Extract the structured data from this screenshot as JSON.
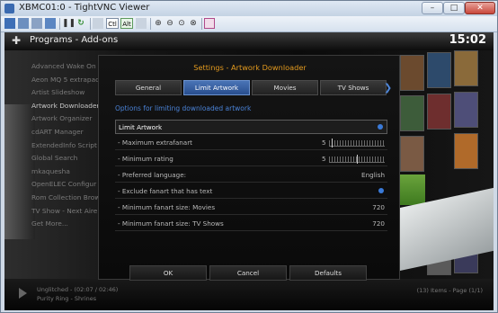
{
  "window": {
    "title": "XBMC01:0 - TightVNC Viewer",
    "controls": {
      "minimize": "–",
      "maximize": "□",
      "close": "✕"
    }
  },
  "toolbar": {
    "icons": [
      "new-connection-icon",
      "save-icon",
      "options-icon",
      "info-icon",
      "pause-icon",
      "refresh-icon",
      "ctrl-alt-del-icon",
      "ctrl-key-icon",
      "alt-key-icon",
      "clipboard-icon",
      "zoom-in-icon",
      "zoom-out-icon",
      "zoom-100-icon",
      "zoom-fit-icon",
      "fullscreen-icon"
    ],
    "ctrl_label": "Ctl",
    "alt_label": "Alt"
  },
  "xbmc": {
    "header_title": "Programs  -  Add-ons",
    "clock": "15:02",
    "list": [
      "Advanced Wake On",
      "Aeon MQ 5 extrapac",
      "Artist Slideshow",
      "Artwork Downloader",
      "Artwork Organizer",
      "cdART Manager",
      "ExtendedInfo Script",
      "Global Search",
      "mkaquesha",
      "OpenELEC Configur",
      "Rom Collection Brow",
      "TV Show - Next Aire",
      "Get More..."
    ],
    "footer": {
      "now_playing_1": "Unglitched - (02:07 / 02:46)",
      "now_playing_2": "Purity Ring - Shrines",
      "items_text": "(13) Items - Page (1/1)"
    }
  },
  "dialog": {
    "title": "Settings - Artwork Downloader",
    "tabs": [
      {
        "label": "General",
        "active": false
      },
      {
        "label": "Limit Artwork",
        "active": true
      },
      {
        "label": "Movies",
        "active": false
      },
      {
        "label": "TV Shows",
        "active": false
      }
    ],
    "section_title": "Options for limiting downloaded artwork",
    "rows": [
      {
        "label": "Limit Artwork",
        "value": "",
        "control": "toggle-on"
      },
      {
        "label": "- Maximum extrafanart",
        "value": "5",
        "control": "slider",
        "level": 0.05
      },
      {
        "label": "- Minimum rating",
        "value": "5",
        "control": "slider",
        "level": 0.5
      },
      {
        "label": "- Preferred language:",
        "value": "English",
        "control": "text"
      },
      {
        "label": "- Exclude fanart that has text",
        "value": "",
        "control": "toggle-on"
      },
      {
        "label": "- Minimum fanart size: Movies",
        "value": "720",
        "control": "text"
      },
      {
        "label": "- Minimum fanart size: TV Shows",
        "value": "720",
        "control": "text"
      }
    ],
    "buttons": {
      "ok": "OK",
      "cancel": "Cancel",
      "defaults": "Defaults"
    }
  },
  "colors": {
    "accent_orange": "#e39a1e",
    "accent_blue": "#4a82d6",
    "tab_active": "#3a65a8"
  }
}
